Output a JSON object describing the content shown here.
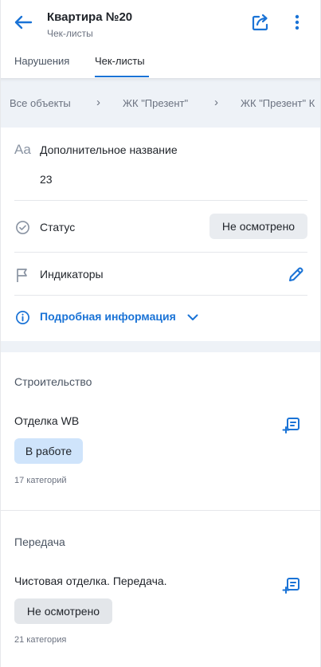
{
  "header": {
    "title": "Квартира №20",
    "subtitle": "Чек-листы",
    "back_icon": "arrow-left-icon",
    "share_icon": "share-icon",
    "more_icon": "more-vertical-icon"
  },
  "tabs": [
    {
      "label": "Нарушения",
      "active": false
    },
    {
      "label": "Чек-листы",
      "active": true
    }
  ],
  "breadcrumbs": {
    "items": [
      "Все объекты",
      "ЖК \"Презент\"",
      "ЖК \"Презент\" К"
    ],
    "separator": "›"
  },
  "info": {
    "name_label": "Дополнительное название",
    "name_value": "23",
    "name_icon_text": "Aa",
    "status_label": "Статус",
    "status_value": "Не осмотрено",
    "indicators_label": "Индикаторы",
    "more_info_label": "Подробная информация"
  },
  "sections": [
    {
      "title": "Строительство",
      "items": [
        {
          "title": "Отделка WB",
          "status": "В работе",
          "count": "17 категорий"
        }
      ]
    },
    {
      "title": "Передача",
      "items": [
        {
          "title": "Чистовая отделка. Передача.",
          "status": "Не осмотрено",
          "count": "21 категория"
        }
      ]
    }
  ],
  "colors": {
    "accent": "#1a73d6",
    "band": "#eef2f7",
    "badge_work": "#cfe4fb",
    "badge_idle": "#e3e6ea"
  }
}
